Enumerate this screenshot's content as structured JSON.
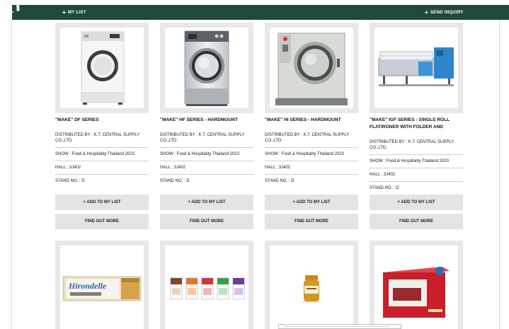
{
  "watermark": "Tr",
  "topbar": {
    "left_label": "MY LIST",
    "right_label": "SEND INQUIRY"
  },
  "products": [
    {
      "title": "\"MAKE\" DF SERIES",
      "distributed_by": "DISTRIBUTED BY : K.T. CENTRAL SUPPLY CO.,LTD.",
      "show": "SHOW : Food & Hospitality Thailand 2023",
      "hall": "HALL : 3J402",
      "stand": "STAND NO. : D",
      "add_label": "+ ADD TO MY LIST",
      "more_label": "FIND OUT MORE"
    },
    {
      "title": "\"MAKE\" HF SERIES - HARDMOUNT",
      "distributed_by": "DISTRIBUTED BY : K.T. CENTRAL SUPPLY CO.,LTD.",
      "show": "SHOW : Food & Hospitality Thailand 2023",
      "hall": "HALL : 3J402",
      "stand": "STAND NO. : D",
      "add_label": "+ ADD TO MY LIST",
      "more_label": "FIND OUT MORE"
    },
    {
      "title": "\"MAKE\" HI SERIES - HARDMOUNT",
      "distributed_by": "DISTRIBUTED BY : K.T. CENTRAL SUPPLY CO.,LTD.",
      "show": "SHOW : Food & Hospitality Thailand 2023",
      "hall": "HALL : 3J402",
      "stand": "STAND NO. : D",
      "add_label": "+ ADD TO MY LIST",
      "more_label": "FIND OUT MORE"
    },
    {
      "title": "\"MAKE\" IGF SERIES - SINGLE ROLL FLATIRONER WITH FOLDER AND",
      "distributed_by": "DISTRIBUTED BY : K.T. CENTRAL SUPPLY CO.,LTD.",
      "show": "SHOW : Food & Hospitality Thailand 2023",
      "hall": "HALL : 3J402",
      "stand": "STAND NO. : D",
      "add_label": "+ ADD TO MY LIST",
      "more_label": "FIND OUT MORE"
    }
  ],
  "row2": {
    "hirondelle_text": "Hirondelle"
  },
  "icons": {
    "topbar_left": "plus-icon",
    "topbar_right": "plus-icon"
  },
  "colors": {
    "topbar": "#1f4a3a",
    "button": "#e4e4e4",
    "image_frame": "#e8e8e8"
  }
}
